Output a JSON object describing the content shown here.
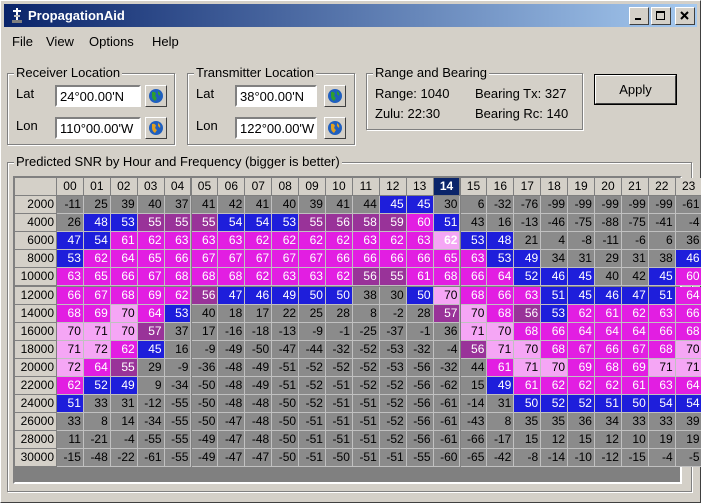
{
  "window": {
    "title": "PropagationAid"
  },
  "menu": [
    "File",
    "View",
    "Options",
    "Help"
  ],
  "receiver": {
    "title": "Receiver Location",
    "lat_label": "Lat",
    "lon_label": "Lon",
    "lat": "24°00.00'N",
    "lon": "110°00.00'W"
  },
  "transmitter": {
    "title": "Transmitter Location",
    "lat_label": "Lat",
    "lon_label": "Lon",
    "lat": "38°00.00'N",
    "lon": "122°00.00'W"
  },
  "range": {
    "title": "Range and Bearing",
    "range_text": "Range: 1040",
    "bearing_tx_text": "Bearing Tx: 327",
    "zulu_text": "Zulu: 22:30",
    "bearing_rc_text": "Bearing Rc: 140"
  },
  "apply_label": "Apply",
  "grid": {
    "title": "Predicted SNR by Hour and Frequency (bigger is better)",
    "selected_hour": 14,
    "hours": [
      "00",
      "01",
      "02",
      "03",
      "04",
      "05",
      "06",
      "07",
      "08",
      "09",
      "10",
      "11",
      "12",
      "13",
      "14",
      "15",
      "16",
      "17",
      "18",
      "19",
      "20",
      "21",
      "22",
      "23"
    ],
    "frequencies": [
      "2000",
      "4000",
      "6000",
      "8000",
      "10000",
      "12000",
      "14000",
      "16000",
      "18000",
      "20000",
      "22000",
      "24000",
      "26000",
      "28000",
      "30000"
    ],
    "values": [
      [
        -11,
        25,
        39,
        40,
        37,
        41,
        42,
        41,
        40,
        39,
        41,
        44,
        45,
        45,
        30,
        6,
        -32,
        -76,
        -99,
        -99,
        -99,
        -99,
        -99,
        -61
      ],
      [
        26,
        48,
        53,
        55,
        55,
        55,
        54,
        54,
        53,
        55,
        56,
        58,
        59,
        60,
        51,
        43,
        16,
        -13,
        -46,
        -75,
        -88,
        -75,
        -41,
        -4
      ],
      [
        47,
        54,
        61,
        62,
        63,
        63,
        63,
        62,
        62,
        62,
        62,
        63,
        62,
        63,
        62,
        53,
        48,
        21,
        4,
        -8,
        -11,
        -6,
        6,
        36
      ],
      [
        53,
        62,
        64,
        65,
        66,
        67,
        67,
        67,
        67,
        67,
        66,
        66,
        66,
        66,
        65,
        63,
        53,
        49,
        34,
        31,
        29,
        31,
        38,
        46
      ],
      [
        63,
        65,
        66,
        67,
        68,
        68,
        68,
        62,
        63,
        63,
        62,
        56,
        55,
        61,
        68,
        66,
        64,
        52,
        46,
        45,
        40,
        42,
        45,
        60
      ],
      [
        66,
        67,
        68,
        69,
        62,
        56,
        47,
        46,
        49,
        50,
        50,
        38,
        30,
        50,
        70,
        68,
        66,
        63,
        51,
        45,
        46,
        47,
        51,
        64
      ],
      [
        68,
        69,
        70,
        64,
        53,
        40,
        18,
        17,
        22,
        25,
        28,
        8,
        -2,
        28,
        57,
        70,
        68,
        56,
        53,
        62,
        61,
        62,
        63,
        66
      ],
      [
        70,
        71,
        70,
        57,
        37,
        17,
        -16,
        -18,
        -13,
        -9,
        -1,
        -25,
        -37,
        -1,
        36,
        71,
        70,
        68,
        66,
        64,
        64,
        64,
        66,
        68
      ],
      [
        71,
        72,
        62,
        45,
        16,
        -9,
        -49,
        -50,
        -47,
        -44,
        -32,
        -52,
        -53,
        -32,
        -4,
        56,
        71,
        70,
        68,
        67,
        66,
        67,
        68,
        70
      ],
      [
        72,
        64,
        55,
        29,
        -9,
        -36,
        -48,
        -49,
        -51,
        -52,
        -52,
        -52,
        -53,
        -56,
        -32,
        44,
        61,
        71,
        70,
        69,
        68,
        69,
        71,
        71
      ],
      [
        62,
        52,
        49,
        9,
        -34,
        -50,
        -48,
        -49,
        -51,
        -52,
        -51,
        -52,
        -52,
        -56,
        -62,
        15,
        49,
        61,
        62,
        62,
        62,
        61,
        63,
        64
      ],
      [
        51,
        33,
        31,
        -12,
        -55,
        -50,
        -48,
        -48,
        -50,
        -52,
        -51,
        -51,
        -52,
        -56,
        -61,
        -14,
        31,
        50,
        52,
        52,
        51,
        50,
        54,
        54
      ],
      [
        33,
        8,
        14,
        -34,
        -55,
        -50,
        -47,
        -48,
        -50,
        -51,
        -51,
        -51,
        -52,
        -56,
        -61,
        -43,
        8,
        35,
        35,
        36,
        34,
        33,
        33,
        39
      ],
      [
        11,
        -21,
        -4,
        -55,
        -55,
        -49,
        -47,
        -48,
        -50,
        -51,
        -51,
        -51,
        -52,
        -56,
        -61,
        -66,
        -17,
        15,
        12,
        15,
        12,
        10,
        19,
        19
      ],
      [
        -15,
        -48,
        -22,
        -61,
        -55,
        -49,
        -47,
        -47,
        -50,
        -51,
        -50,
        -51,
        -51,
        -55,
        -60,
        -65,
        -42,
        -8,
        -14,
        -10,
        -12,
        -15,
        -4,
        -5
      ]
    ],
    "colors": {
      "grey": "#8b8b8b",
      "blue": "#1e1edb",
      "dark_magenta": "#993399",
      "magenta": "#e21ee2",
      "light_magenta": "#f5a6f5",
      "selected_bg": "#0a246a"
    }
  }
}
